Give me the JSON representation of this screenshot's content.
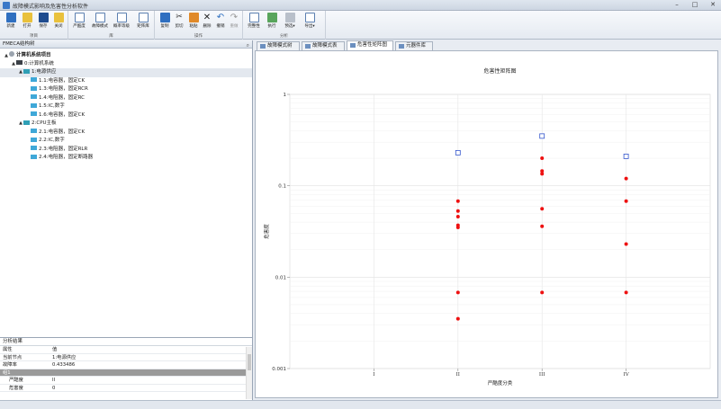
{
  "window": {
    "title": "故障模式影响及危害性分析软件"
  },
  "ribbon": {
    "groups": [
      {
        "name": "项目",
        "buttons": [
          "新建",
          "打开",
          "保存",
          "关闭"
        ]
      },
      {
        "name": "库",
        "buttons": [
          "严酷度",
          "故障模式",
          "概率等级",
          "矩阵库"
        ]
      },
      {
        "name": "操作",
        "buttons": [
          "复制",
          "剪切",
          "粘贴",
          "删除",
          "撤销",
          "重做"
        ]
      },
      {
        "name": "分析",
        "buttons": [
          "完整性",
          "执行",
          "预选▾",
          "导出▾"
        ]
      }
    ]
  },
  "tree_panel": {
    "title": "FMECA结构树",
    "nodes": [
      {
        "label": "计算机系统项目",
        "level": 0,
        "toggle": "▲",
        "icon": "root",
        "bold": true
      },
      {
        "label": "0:计算机系统",
        "level": 1,
        "toggle": "▲",
        "icon": "sys"
      },
      {
        "label": "1:电源供应",
        "level": 2,
        "toggle": "▲",
        "icon": "teal",
        "selected": true
      },
      {
        "label": "1.1:电容器，固定CK",
        "level": 3,
        "toggle": "",
        "icon": "cyan"
      },
      {
        "label": "1.3:电阻器，固定RCR",
        "level": 3,
        "toggle": "",
        "icon": "cyan"
      },
      {
        "label": "1.4:电阻器，固定RC",
        "level": 3,
        "toggle": "",
        "icon": "cyan"
      },
      {
        "label": "1.5:IC,数字",
        "level": 3,
        "toggle": "",
        "icon": "cyan"
      },
      {
        "label": "1.6:电容器，固定CK",
        "level": 3,
        "toggle": "",
        "icon": "cyan"
      },
      {
        "label": "2:CPU主板",
        "level": 2,
        "toggle": "▲",
        "icon": "teal"
      },
      {
        "label": "2.1:电容器，固定CK",
        "level": 3,
        "toggle": "",
        "icon": "cyan"
      },
      {
        "label": "2.2:IC,数字",
        "level": 3,
        "toggle": "",
        "icon": "cyan"
      },
      {
        "label": "2.3:电阻器，固定RLR",
        "level": 3,
        "toggle": "",
        "icon": "cyan"
      },
      {
        "label": "2.4:电阻器，固定断路器",
        "level": 3,
        "toggle": "",
        "icon": "cyan"
      }
    ]
  },
  "results_panel": {
    "title": "分析结果",
    "rows": [
      {
        "k": "属性",
        "v": "值",
        "style": ""
      },
      {
        "k": "当前节点",
        "v": "1:电源供应",
        "style": ""
      },
      {
        "k": "故障率",
        "v": "0.433486",
        "style": ""
      },
      {
        "k": "组1",
        "v": "",
        "style": "dark"
      },
      {
        "k": "严酷度",
        "v": "II",
        "style": "sub"
      },
      {
        "k": "危害度",
        "v": "0",
        "style": "sub"
      }
    ]
  },
  "tabs": [
    {
      "label": "故障模式树",
      "active": false
    },
    {
      "label": "故障模式表",
      "active": false
    },
    {
      "label": "危害性矩阵图",
      "active": true
    },
    {
      "label": "元器件库",
      "active": false
    }
  ],
  "chart_data": {
    "type": "scatter",
    "title": "危害性矩阵图",
    "xlabel": "严酷度分类",
    "ylabel": "危害度",
    "categories": [
      "I",
      "II",
      "III",
      "IV"
    ],
    "y_scale": "log",
    "ylim": [
      0.001,
      1
    ],
    "y_ticks": [
      "0.001",
      "0.01",
      "0.1",
      "1"
    ],
    "grid": true,
    "series": [
      {
        "marker": "square",
        "color": "#3355cc",
        "points": [
          {
            "x": "II",
            "y": 0.23
          },
          {
            "x": "III",
            "y": 0.35
          },
          {
            "x": "IV",
            "y": 0.21
          }
        ]
      },
      {
        "marker": "circle",
        "color": "#ee1111",
        "points": [
          {
            "x": "II",
            "y": 0.068
          },
          {
            "x": "II",
            "y": 0.053
          },
          {
            "x": "II",
            "y": 0.046
          },
          {
            "x": "II",
            "y": 0.037
          },
          {
            "x": "II",
            "y": 0.035
          },
          {
            "x": "II",
            "y": 0.0068
          },
          {
            "x": "II",
            "y": 0.0035
          },
          {
            "x": "III",
            "y": 0.2
          },
          {
            "x": "III",
            "y": 0.145
          },
          {
            "x": "III",
            "y": 0.135
          },
          {
            "x": "III",
            "y": 0.056
          },
          {
            "x": "III",
            "y": 0.036
          },
          {
            "x": "III",
            "y": 0.0068
          },
          {
            "x": "IV",
            "y": 0.12
          },
          {
            "x": "IV",
            "y": 0.068
          },
          {
            "x": "IV",
            "y": 0.023
          },
          {
            "x": "IV",
            "y": 0.0068
          }
        ]
      }
    ]
  }
}
